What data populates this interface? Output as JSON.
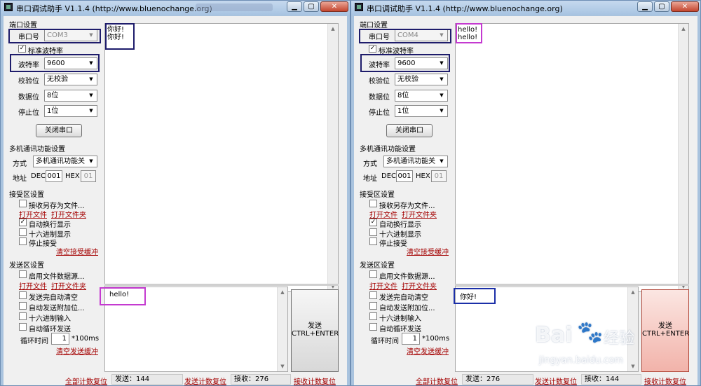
{
  "windows": [
    {
      "id": "left",
      "title": "串口调试助手 V1.1.4 (http://www.bluenochange.org)",
      "port_group_title": "端口设置",
      "port_label": "串口号",
      "port_value": "COM3",
      "std_baud_label": "标准波特率",
      "baud_label": "波特率",
      "baud_value": "9600",
      "parity_label": "校验位",
      "parity_value": "无校验",
      "databits_label": "数据位",
      "databits_value": "8位",
      "stopbits_label": "停止位",
      "stopbits_value": "1位",
      "close_port_button": "关闭串口",
      "multi_group_title": "多机通讯功能设置",
      "mode_label": "方式",
      "mode_value": "多机通讯功能关",
      "addr_label": "地址",
      "dec_label": "DEC",
      "dec_value": "001",
      "hex_label": "HEX",
      "hex_value": "01",
      "recv_group_title": "接受区设置",
      "recv_save_label": "接收另存为文件...",
      "recv_open_file": "打开文件",
      "recv_open_folder": "打开文件夹",
      "auto_newline_label": "自动换行显示",
      "hex_display_label": "十六进制显示",
      "stop_recv_label": "停止接受",
      "clear_recv_link": "清空接受缓冲",
      "send_group_title": "发送区设置",
      "file_source_label": "启用文件数据源...",
      "send_open_file": "打开文件",
      "send_open_folder": "打开文件夹",
      "auto_clear_label": "发送完自动清空",
      "append_label": "自动发送附加位...",
      "hex_input_label": "十六进制输入",
      "loop_send_label": "自动循环发送",
      "loop_time_label": "循环时间",
      "loop_time_value": "1",
      "loop_unit": "*100ms",
      "clear_send_link": "清空发送缓冲",
      "recv_lines": [
        "你好!",
        "你好!"
      ],
      "send_text": "hello!",
      "send_button_line1": "发送",
      "send_button_line2": "CTRL+ENTER",
      "reset_all": "全部计数复位",
      "sent_count": "发送：144",
      "reset_sent": "发送计数复位",
      "recv_count": "接收：276",
      "reset_recv": "接收计数复位"
    },
    {
      "id": "right",
      "title": "串口调试助手 V1.1.4 (http://www.bluenochange.org)",
      "port_group_title": "端口设置",
      "port_label": "串口号",
      "port_value": "COM4",
      "std_baud_label": "标准波特率",
      "baud_label": "波特率",
      "baud_value": "9600",
      "parity_label": "校验位",
      "parity_value": "无校验",
      "databits_label": "数据位",
      "databits_value": "8位",
      "stopbits_label": "停止位",
      "stopbits_value": "1位",
      "close_port_button": "关闭串口",
      "multi_group_title": "多机通讯功能设置",
      "mode_label": "方式",
      "mode_value": "多机通讯功能关",
      "addr_label": "地址",
      "dec_label": "DEC",
      "dec_value": "001",
      "hex_label": "HEX",
      "hex_value": "01",
      "recv_group_title": "接受区设置",
      "recv_save_label": "接收另存为文件...",
      "recv_open_file": "打开文件",
      "recv_open_folder": "打开文件夹",
      "auto_newline_label": "自动换行显示",
      "hex_display_label": "十六进制显示",
      "stop_recv_label": "停止接受",
      "clear_recv_link": "清空接受缓冲",
      "send_group_title": "发送区设置",
      "file_source_label": "启用文件数据源...",
      "send_open_file": "打开文件",
      "send_open_folder": "打开文件夹",
      "auto_clear_label": "发送完自动清空",
      "append_label": "自动发送附加位...",
      "hex_input_label": "十六进制输入",
      "loop_send_label": "自动循环发送",
      "loop_time_label": "循环时间",
      "loop_time_value": "1",
      "loop_unit": "*100ms",
      "clear_send_link": "清空发送缓冲",
      "recv_lines": [
        "hello!",
        "hello!"
      ],
      "send_text": "你好!",
      "send_button_line1": "发送",
      "send_button_line2": "CTRL+ENTER",
      "reset_all": "全部计数复位",
      "sent_count": "发送：276",
      "reset_sent": "发送计数复位",
      "recv_count": "接收：144",
      "reset_recv": "接收计数复位"
    }
  ],
  "watermark": {
    "brand": "Bai",
    "brand_suffix": "经验",
    "url": "jingyan.baidu.com"
  },
  "icons": {
    "minimize": "minimize-icon",
    "maximize": "maximize-icon",
    "close": "close-icon",
    "dropdown": "chevron-down-icon",
    "check": "checkmark-icon",
    "paw": "baidu-paw-icon"
  },
  "colors": {
    "highlight_navy": "#1e1c6b",
    "highlight_purple": "#c43ad0",
    "highlight_blue": "#1b2fa8",
    "link_red": "#a40000"
  }
}
